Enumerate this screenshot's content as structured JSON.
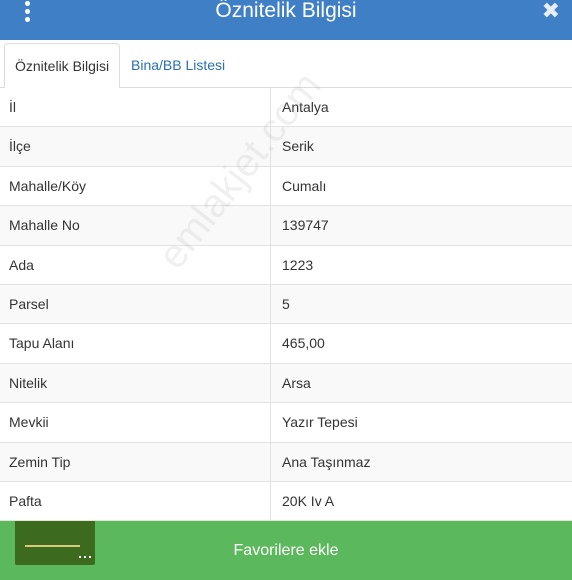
{
  "header": {
    "title": "Öznitelik Bilgisi",
    "menu_icon": "vertical-dots-icon",
    "close_icon": "close-icon",
    "close_glyph": "✖"
  },
  "tabs": [
    {
      "label": "Öznitelik Bilgisi",
      "active": true
    },
    {
      "label": "Bina/BB Listesi",
      "active": false
    }
  ],
  "attributes": [
    {
      "key": "İl",
      "value": "Antalya"
    },
    {
      "key": "İlçe",
      "value": "Serik"
    },
    {
      "key": "Mahalle/Köy",
      "value": "Cumalı"
    },
    {
      "key": "Mahalle No",
      "value": "139747"
    },
    {
      "key": "Ada",
      "value": "1223"
    },
    {
      "key": "Parsel",
      "value": "5"
    },
    {
      "key": "Tapu Alanı",
      "value": "465,00"
    },
    {
      "key": "Nitelik",
      "value": "Arsa"
    },
    {
      "key": "Mevkii",
      "value": "Yazır Tepesi"
    },
    {
      "key": "Zemin Tip",
      "value": "Ana Taşınmaz"
    },
    {
      "key": "Pafta",
      "value": "20K Iv A"
    }
  ],
  "watermark": "emlakjet.com",
  "footer": {
    "button_label": "Favorilere ekle"
  },
  "colors": {
    "header_bg": "#3f7fc6",
    "footer_bg": "#5cb85c",
    "tab_link": "#2a6fb5"
  }
}
